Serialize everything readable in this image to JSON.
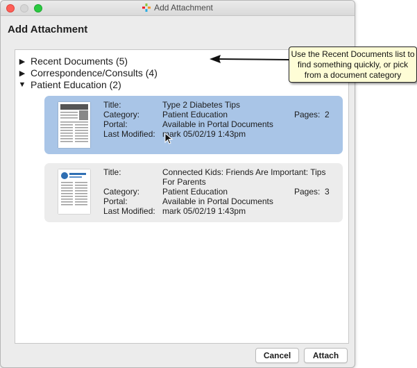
{
  "window": {
    "title": "Add Attachment"
  },
  "dialog": {
    "heading": "Add Attachment"
  },
  "tree": [
    {
      "label": "Recent Documents (5)",
      "expanded": false
    },
    {
      "label": "Correspondence/Consults (4)",
      "expanded": false
    },
    {
      "label": "Patient Education (2)",
      "expanded": true
    }
  ],
  "labels": {
    "title": "Title:",
    "category": "Category:",
    "portal": "Portal:",
    "last_modified": "Last Modified:",
    "pages": "Pages:"
  },
  "documents": [
    {
      "title": "Type 2 Diabetes Tips",
      "category": "Patient Education",
      "portal": "Available in Portal Documents",
      "last_modified": "mark 05/02/19 1:43pm",
      "pages": "2",
      "selected": true
    },
    {
      "title": "Connected Kids: Friends Are Important: Tips For Parents",
      "category": "Patient Education",
      "portal": "Available in Portal Documents",
      "last_modified": "mark 05/02/19 1:43pm",
      "pages": "3",
      "selected": false
    }
  ],
  "buttons": {
    "cancel": "Cancel",
    "attach": "Attach"
  },
  "callout": {
    "text": "Use the Recent Documents list to find something quickly, or pick from a document category"
  },
  "colors": {
    "selected_card": "#a9c5e7",
    "normal_card": "#ececec",
    "callout_bg": "#fefdd6"
  }
}
